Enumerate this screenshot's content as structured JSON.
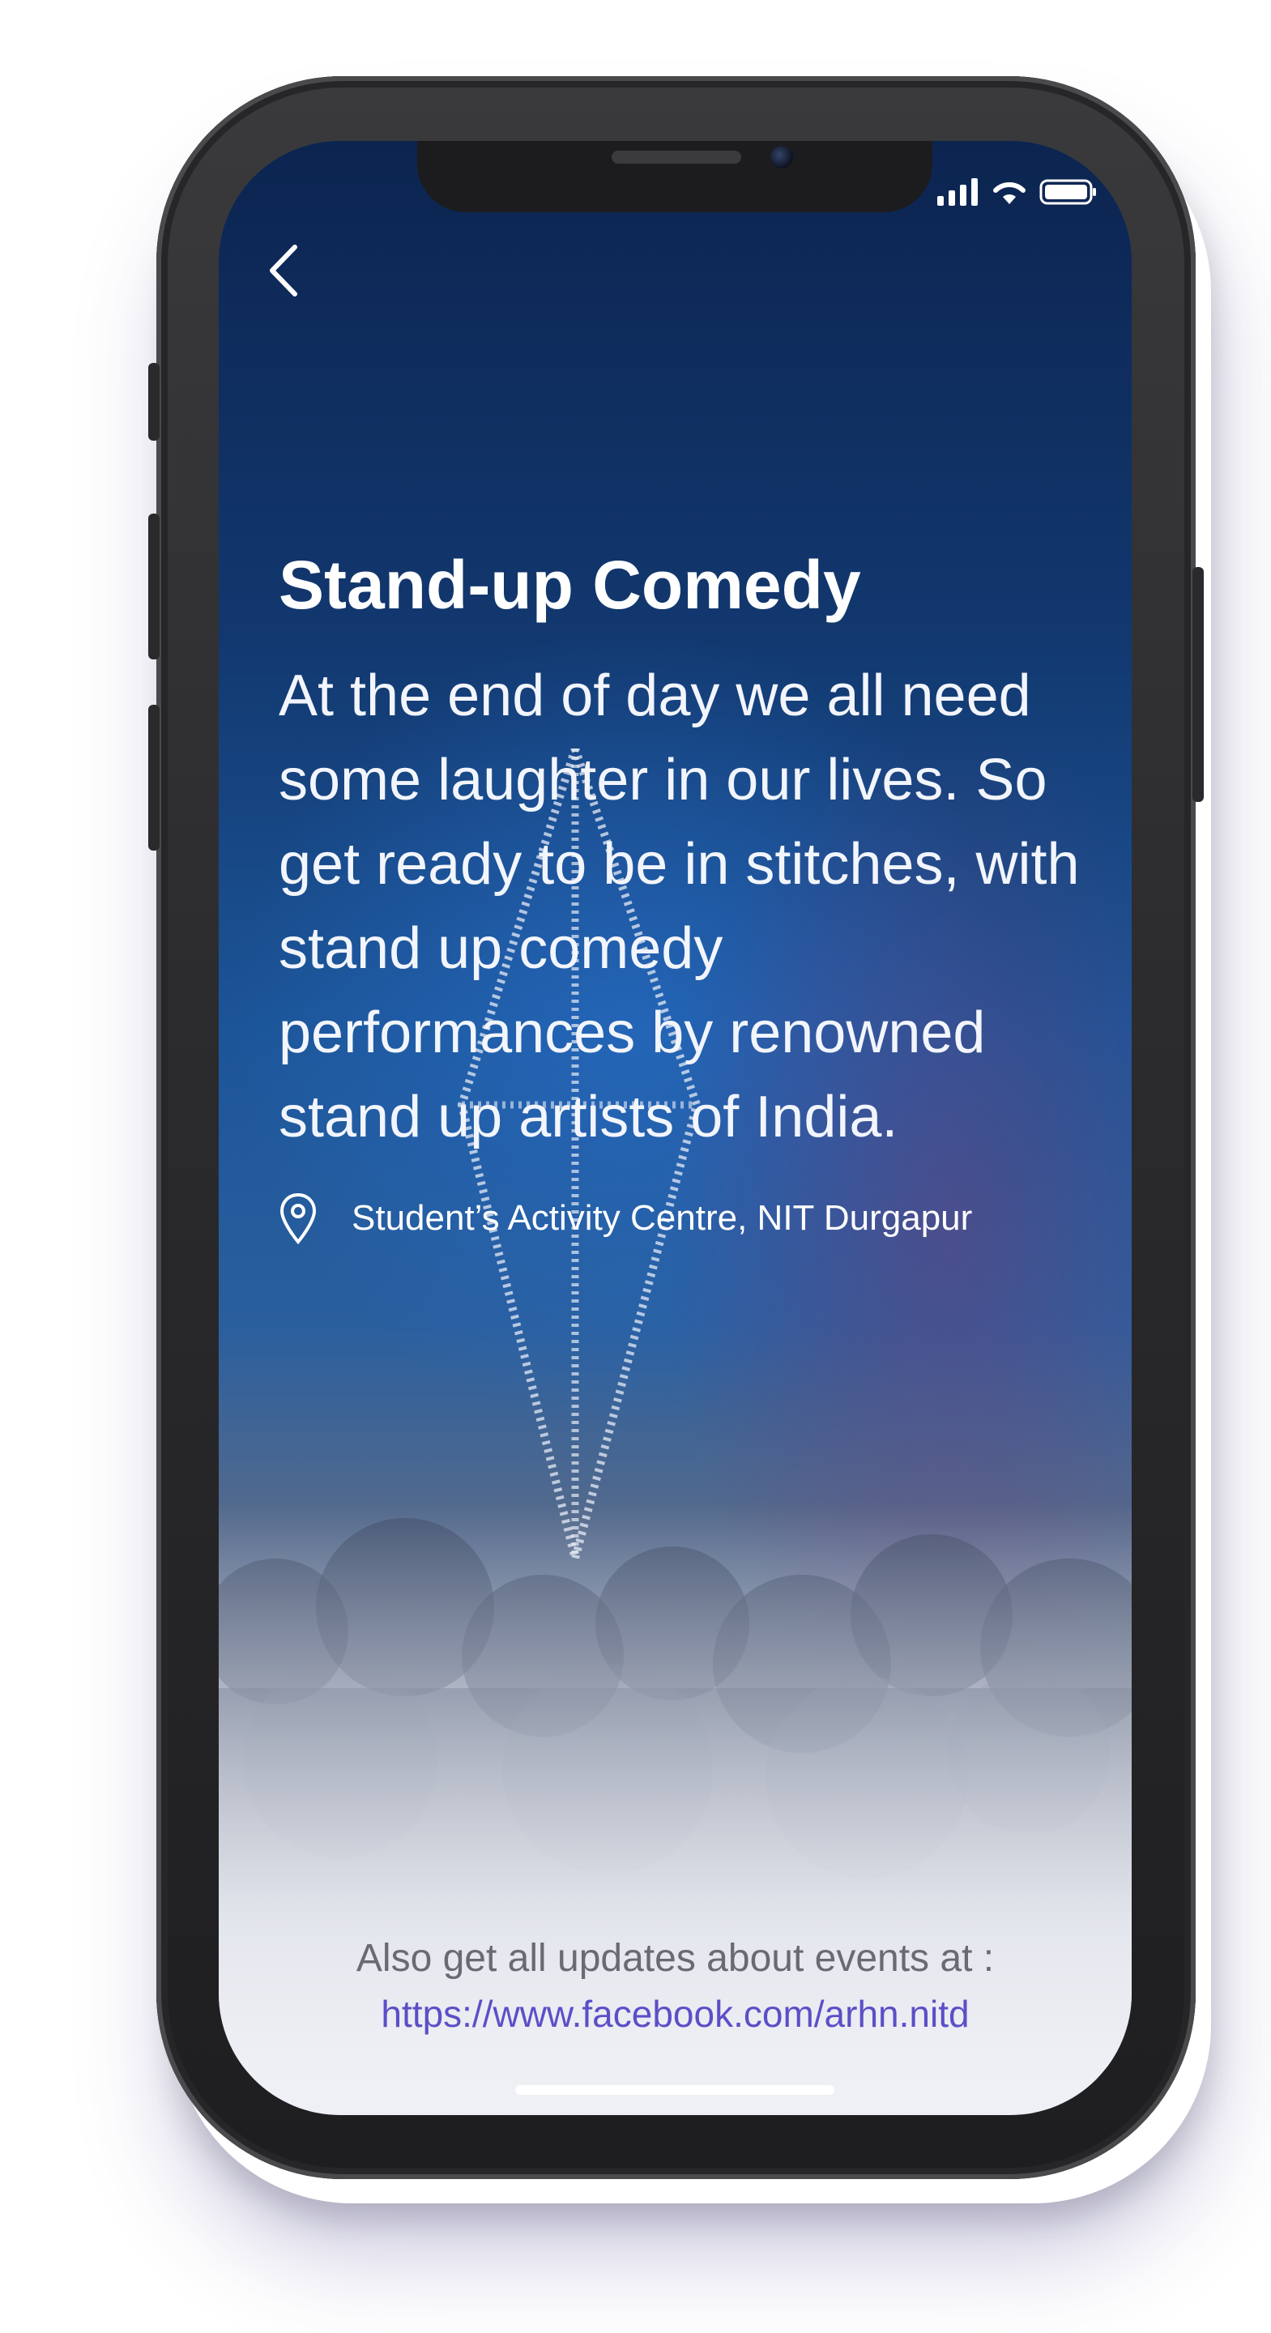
{
  "event": {
    "title": "Stand-up Comedy",
    "description": "At the end of day we all need some laughter in our lives. So get ready to be in stitches, with stand up comedy performances by renowned stand up artists of India.",
    "location": "Student’s Activity Centre, NIT Durgapur"
  },
  "footer": {
    "text": "Also get all updates about events at :",
    "link": "https://www.facebook.com/arhn.nitd"
  },
  "icons": {
    "back": "chevron-left-icon",
    "location": "map-pin-icon",
    "signal": "cellular-signal-icon",
    "wifi": "wifi-icon",
    "battery": "battery-icon"
  },
  "colors": {
    "link": "#5b4fc7",
    "footer_text": "#6a6a72",
    "title": "#ffffff"
  }
}
